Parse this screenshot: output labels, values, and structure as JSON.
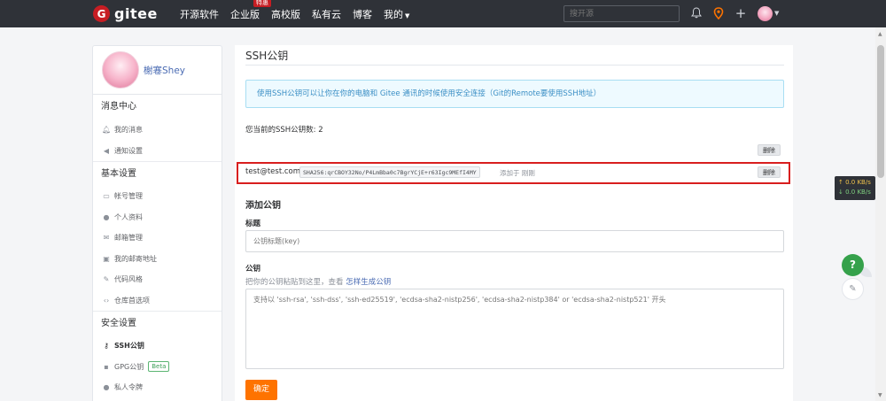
{
  "nav": {
    "logo_letter": "G",
    "logo_text": "gitee",
    "links": [
      "开源软件",
      "企业版",
      "高校版",
      "私有云",
      "博客"
    ],
    "enterprise_badge": "特惠",
    "mine_label": "我的",
    "search_placeholder": "搜开源"
  },
  "sidebar": {
    "username": "榭寋Shey",
    "sections": [
      {
        "title": "消息中心",
        "items": [
          {
            "label": "我的消息",
            "icon": "bell-icon"
          },
          {
            "label": "通知设置",
            "icon": "speaker-icon"
          }
        ]
      },
      {
        "title": "基本设置",
        "items": [
          {
            "label": "帐号管理",
            "icon": "id-card-icon"
          },
          {
            "label": "个人资料",
            "icon": "user-icon"
          },
          {
            "label": "邮箱管理",
            "icon": "mail-icon"
          },
          {
            "label": "我的邮寄地址",
            "icon": "address-card-icon"
          },
          {
            "label": "代码风格",
            "icon": "brush-icon"
          },
          {
            "label": "仓库首选项",
            "icon": "code-icon"
          }
        ]
      },
      {
        "title": "安全设置",
        "items": [
          {
            "label": "SSH公钥",
            "icon": "key-icon",
            "active": true
          },
          {
            "label": "GPG公钥",
            "icon": "lock-icon",
            "badge": "Beta"
          },
          {
            "label": "私人令牌",
            "icon": "users-icon"
          }
        ]
      }
    ]
  },
  "main": {
    "title": "SSH公钥",
    "info": "使用SSH公钥可以让你在你的电脑和 Gitee 通讯的时候使用安全连接（Git的Remote要使用SSH地址）",
    "count_text": "您当前的SSH公钥数: 2",
    "delete_label": "删除",
    "key": {
      "email": "test@test.com",
      "fingerprint": "SHA256:qrCBOY32No/P4LmBba0c7BgrYCjE+r63Igc9MEfI4MY",
      "added": "添加于 刚刚"
    },
    "add_title": "添加公钥",
    "title_label": "标题",
    "title_placeholder": "公钥标题(key)",
    "key_label": "公钥",
    "hint_text": "把你的公钥粘贴到这里，查看",
    "hint_link": "怎样生成公钥",
    "key_placeholder": "支持以 'ssh-rsa', 'ssh-dss', 'ssh-ed25519', 'ecdsa-sha2-nistp256', 'ecdsa-sha2-nistp384' or 'ecdsa-sha2-nistp521' 开头",
    "confirm_label": "确定"
  },
  "widgets": {
    "net_up": "↑ 0.0 KB/s",
    "net_down": "↓ 0.0 KB/s",
    "help": "?"
  }
}
